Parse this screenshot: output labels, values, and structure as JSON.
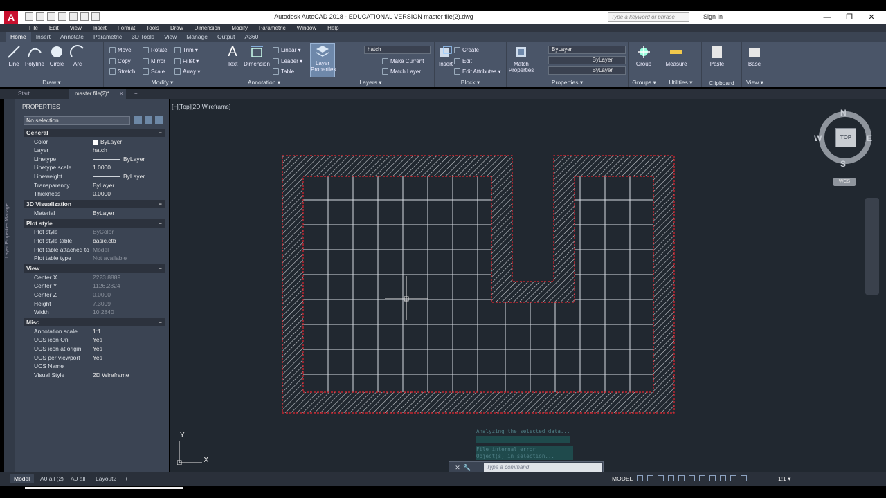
{
  "window": {
    "title": "Autodesk AutoCAD 2018 - EDUCATIONAL VERSION    master file(2).dwg",
    "app_logo": "A",
    "search_placeholder": "Type a keyword or phrase",
    "signin": "Sign In",
    "min": "—",
    "max": "❐",
    "close": "✕"
  },
  "menu": [
    "File",
    "Edit",
    "View",
    "Insert",
    "Format",
    "Tools",
    "Draw",
    "Dimension",
    "Modify",
    "Parametric",
    "Window",
    "Help"
  ],
  "ribbon_tabs": [
    "Home",
    "Insert",
    "Annotate",
    "Parametric",
    "3D Tools",
    "View",
    "Manage",
    "Output",
    "A360"
  ],
  "ribbon": {
    "draw": {
      "title": "Draw ▾",
      "line": "Line",
      "polyline": "Polyline",
      "circle": "Circle",
      "arc": "Arc"
    },
    "modify": {
      "title": "Modify ▾",
      "move": "Move",
      "rotate": "Rotate",
      "trim": "Trim ▾",
      "copy": "Copy",
      "mirror": "Mirror",
      "fillet": "Fillet ▾",
      "stretch": "Stretch",
      "scale": "Scale",
      "array": "Array ▾"
    },
    "annotation": {
      "title": "Annotation ▾",
      "text": "Text",
      "dimension": "Dimension",
      "linear": "Linear ▾",
      "leader": "Leader ▾",
      "table": "Table"
    },
    "layers": {
      "title": "Layers ▾",
      "layer_properties": "Layer Properties",
      "current_layer": "hatch",
      "make_current": "Make Current",
      "match_layer": "Match Layer"
    },
    "block": {
      "title": "Block ▾",
      "insert": "Insert",
      "create": "Create",
      "edit": "Edit",
      "edit_attributes": "Edit Attributes ▾"
    },
    "properties": {
      "title": "Properties ▾",
      "match_properties": "Match Properties",
      "color": "ByLayer",
      "linetype": "ByLayer",
      "lineweight": "ByLayer"
    },
    "groups": {
      "title": "Groups ▾",
      "group": "Group"
    },
    "utilities": {
      "title": "Utilities ▾",
      "measure": "Measure"
    },
    "clipboard": {
      "title": "Clipboard",
      "paste": "Paste"
    },
    "view": {
      "title": "View ▾",
      "base": "Base"
    }
  },
  "doc_tabs": {
    "start": "Start",
    "file": "master file(2)*",
    "close": "✕",
    "add": "+"
  },
  "palette": {
    "side_label": "Layer Properties Manager",
    "title": "PROPERTIES",
    "selection": "No selection",
    "sections": [
      {
        "name": "General",
        "rows": [
          {
            "name": "Color",
            "value": "ByLayer",
            "kind": "swatch"
          },
          {
            "name": "Layer",
            "value": "hatch"
          },
          {
            "name": "Linetype",
            "value": "ByLayer",
            "kind": "line"
          },
          {
            "name": "Linetype scale",
            "value": "1.0000"
          },
          {
            "name": "Lineweight",
            "value": "ByLayer",
            "kind": "line"
          },
          {
            "name": "Transparency",
            "value": "ByLayer"
          },
          {
            "name": "Thickness",
            "value": "0.0000"
          }
        ]
      },
      {
        "name": "3D Visualization",
        "rows": [
          {
            "name": "Material",
            "value": "ByLayer"
          }
        ]
      },
      {
        "name": "Plot style",
        "rows": [
          {
            "name": "Plot style",
            "value": "ByColor",
            "dim": true
          },
          {
            "name": "Plot style table",
            "value": "basic.ctb"
          },
          {
            "name": "Plot table attached to",
            "value": "Model",
            "dim": true
          },
          {
            "name": "Plot table type",
            "value": "Not available",
            "dim": true
          }
        ]
      },
      {
        "name": "View",
        "rows": [
          {
            "name": "Center X",
            "value": "2223.8889",
            "dim": true
          },
          {
            "name": "Center Y",
            "value": "1126.2824",
            "dim": true
          },
          {
            "name": "Center Z",
            "value": "0.0000",
            "dim": true
          },
          {
            "name": "Height",
            "value": "7.3099",
            "dim": true
          },
          {
            "name": "Width",
            "value": "10.2840",
            "dim": true
          }
        ]
      },
      {
        "name": "Misc",
        "rows": [
          {
            "name": "Annotation scale",
            "value": "1:1"
          },
          {
            "name": "UCS icon On",
            "value": "Yes"
          },
          {
            "name": "UCS icon at origin",
            "value": "Yes"
          },
          {
            "name": "UCS per viewport",
            "value": "Yes"
          },
          {
            "name": "UCS Name",
            "value": ""
          },
          {
            "name": "Visual Style",
            "value": "2D Wireframe"
          }
        ]
      }
    ]
  },
  "viewport": {
    "label": "[−][Top][2D Wireframe]",
    "compass": {
      "n": "N",
      "s": "S",
      "e": "E",
      "w": "W",
      "top": "TOP",
      "wcs": "WCS"
    },
    "ucs_x": "X",
    "ucs_y": "Y",
    "command_history": [
      "Analyzing the selected data...",
      "",
      "File internal error",
      "Object(s) in selection..."
    ]
  },
  "command_line": {
    "placeholder": "Type a command",
    "close": "✕",
    "wrench": "🔧"
  },
  "status": {
    "layout_tabs": [
      "Model",
      "A0 all (2)",
      "A0 all",
      "Layout2"
    ],
    "add_tab": "+",
    "model": "MODEL",
    "scale": "1:1 ▾"
  },
  "colors": {
    "viewport_bg": "#212830",
    "hatch_boundary": "#e0242f",
    "grid_lines": "#d8dce2",
    "ribbon_bg": "#4a5568",
    "palette_bg": "#3b4453"
  }
}
